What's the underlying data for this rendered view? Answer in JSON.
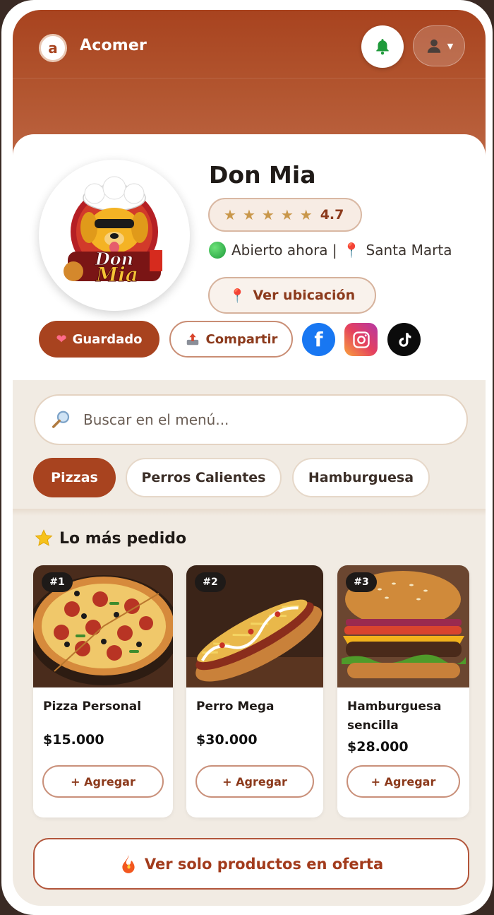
{
  "app": {
    "title": "Acomer",
    "logo_letter": "a"
  },
  "restaurant": {
    "name": "Don Mia",
    "logo_text": "Don Mia",
    "rating": "4.7",
    "stars": 5,
    "status": "Abierto ahora |",
    "city": "Santa Marta",
    "location_button": "Ver ubicación",
    "saved_label": "Guardado",
    "share_label": "Compartir"
  },
  "search": {
    "placeholder": "Buscar en el menú..."
  },
  "categories": [
    {
      "label": "Pizzas",
      "active": true
    },
    {
      "label": "Perros Calientes",
      "active": false
    },
    {
      "label": "Hamburguesa",
      "active": false
    }
  ],
  "section": {
    "title": "Lo más pedido"
  },
  "products": [
    {
      "rank": "#1",
      "name": "Pizza Personal",
      "price": "$15.000",
      "add_label": "+ Agregar"
    },
    {
      "rank": "#2",
      "name": "Perro Mega",
      "price": "$30.000",
      "add_label": "+ Agregar"
    },
    {
      "rank": "#3",
      "name": "Hamburguesa sencilla",
      "price": "$28.000",
      "add_label": "+ Agregar"
    }
  ],
  "offer_button": "Ver solo productos en oferta",
  "colors": {
    "brand": "#a8431f",
    "background": "#f1ebe3",
    "accent_text": "#8c3a1c"
  },
  "icons": [
    "bell-icon",
    "user-icon",
    "star-icon",
    "green-status-icon",
    "map-pin-icon",
    "heart-icon",
    "share-tray-icon",
    "facebook-icon",
    "instagram-icon",
    "tiktok-icon",
    "search-magnifier-icon",
    "star-emoji-icon",
    "fire-icon"
  ]
}
